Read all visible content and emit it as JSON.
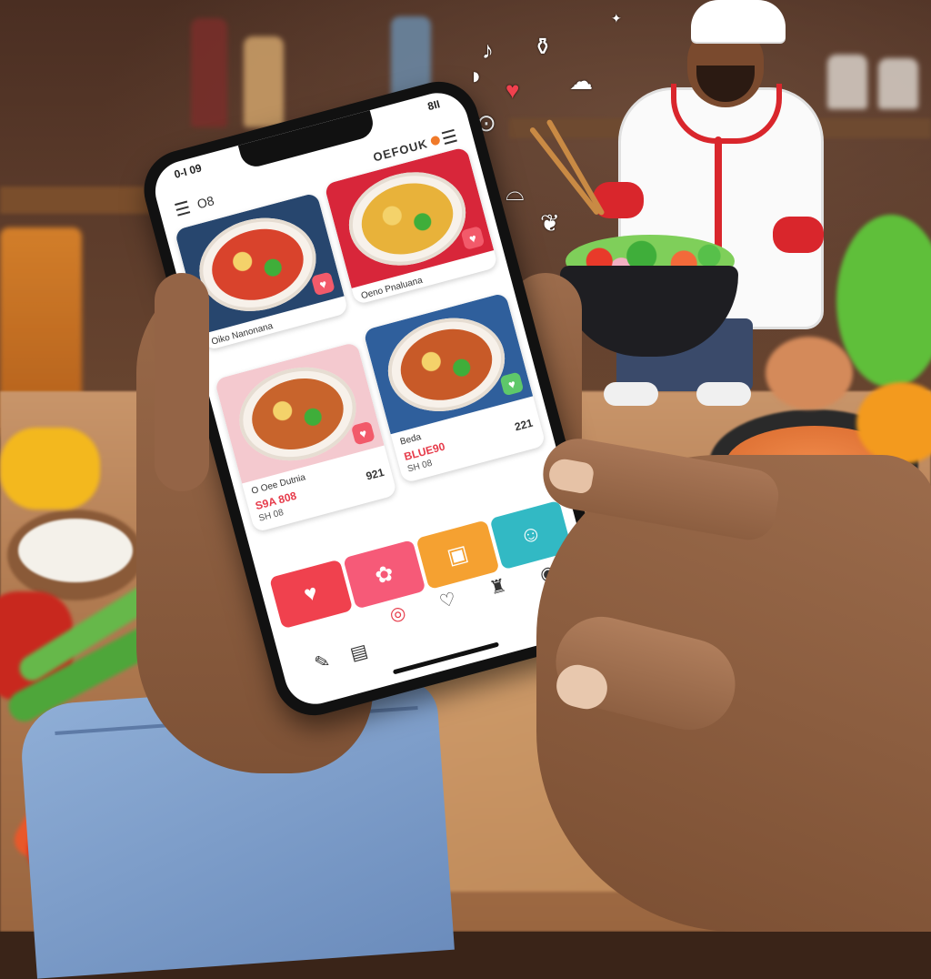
{
  "status_bar": {
    "time": "0-I 09",
    "right": "8II"
  },
  "header": {
    "left_text": "O8",
    "brand": "OEFOUK"
  },
  "cards": [
    {
      "title": "Oiko Nanonana",
      "colors": {
        "bg": "#27466e",
        "food": "#d9432c"
      },
      "badge": "♥",
      "badge_color": "red"
    },
    {
      "title": "Oeno Pnaluana",
      "colors": {
        "bg": "#d8263a",
        "food": "#e8b23a"
      },
      "badge": "♥",
      "badge_color": "red"
    },
    {
      "title": "O Oee Dutnia",
      "price_main": "S9A 808",
      "price_alt": "921",
      "price_sub": "SH 08",
      "colors": {
        "bg": "#f4c9cf",
        "food": "#c8642c"
      },
      "badge": "♥",
      "badge_color": "red"
    },
    {
      "title": "Beda",
      "price_main": "BLUE90",
      "price_alt": "221",
      "price_sub": "SH 08",
      "colors": {
        "bg": "#2f5f9c",
        "food": "#c85a28"
      },
      "badge": "♥",
      "badge_color": "green"
    }
  ],
  "action_tiles": [
    {
      "icon": "heart-icon",
      "glyph": "♥",
      "color": "#f0414e"
    },
    {
      "icon": "chef-hat-icon",
      "glyph": "✿",
      "color": "#f65a78"
    },
    {
      "icon": "menu-book-icon",
      "glyph": "▣",
      "color": "#f5a131"
    },
    {
      "icon": "smile-icon",
      "glyph": "☺",
      "color": "#32b9c4"
    }
  ],
  "icons_row1": [
    {
      "icon": "location-icon",
      "glyph": "◎"
    },
    {
      "icon": "heart-outline-icon",
      "glyph": "♡"
    },
    {
      "icon": "chef-icon",
      "glyph": "♜"
    },
    {
      "icon": "camera-icon",
      "glyph": "◉"
    }
  ],
  "icons_row2": [
    {
      "icon": "edit-icon",
      "glyph": "✎"
    },
    {
      "icon": "wallet-icon",
      "glyph": "▤"
    }
  ]
}
